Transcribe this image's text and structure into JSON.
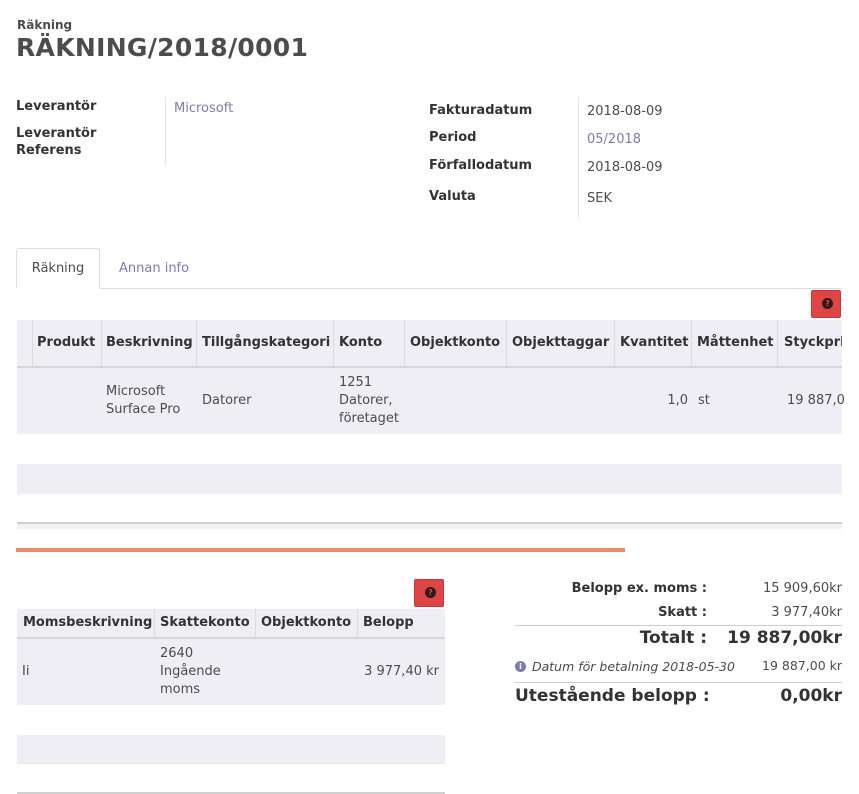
{
  "header": {
    "doc_type": "Räkning",
    "title": "RÄKNING/2018/0001"
  },
  "fields_left": {
    "supplier_label": "Leverantör",
    "supplier_value": "Microsoft",
    "ref_label_1": "Leverantör",
    "ref_label_2": "Referens",
    "ref_value": ""
  },
  "fields_right": {
    "invoice_date_label": "Fakturadatum",
    "invoice_date_value": "2018-08-09",
    "period_label": "Period",
    "period_value": "05/2018",
    "due_date_label": "Förfallodatum",
    "due_date_value": "2018-08-09",
    "currency_label": "Valuta",
    "currency_value": "SEK"
  },
  "tabs": [
    {
      "label": "Räkning",
      "active": true
    },
    {
      "label": "Annan info",
      "active": false
    }
  ],
  "lines": {
    "columns": [
      "Produkt",
      "Beskrivning",
      "Tillgångskategori",
      "Konto",
      "Objektkonto",
      "Objekttaggar",
      "Kvantitet",
      "Måttenhet",
      "Styckpri"
    ],
    "rows": [
      {
        "product": "",
        "description_1": "Microsoft",
        "description_2": "Surface Pro",
        "asset_category": "Datorer",
        "account_1": "1251",
        "account_2": "Datorer,",
        "account_3": "företaget",
        "analytic_account": "",
        "analytic_tags": "",
        "quantity": "1,0",
        "uom": "st",
        "unit_price": "19 887,0"
      }
    ]
  },
  "taxes": {
    "columns": [
      "Momsbeskrivning",
      "Skattekonto",
      "Objektkonto",
      "Belopp"
    ],
    "rows": [
      {
        "description": "Ii",
        "account_1": "2640",
        "account_2": "Ingående",
        "account_3": "moms",
        "analytic": "",
        "amount": "3 977,40 kr"
      }
    ]
  },
  "totals": {
    "untaxed_label": "Belopp ex. moms :",
    "untaxed_value": "15 909,60kr",
    "tax_label": "Skatt :",
    "tax_value": "3 977,40kr",
    "total_label": "Totalt :",
    "total_value": "19 887,00kr",
    "payment_label": "Datum för betalning 2018-05-30",
    "payment_value": "19 887,00 kr",
    "residual_label": "Utestående belopp :",
    "residual_value": "0,00kr"
  },
  "colors": {
    "accent": "#7c7bad",
    "help_button": "#e04545",
    "progress": "#f0896a",
    "row_bg": "#eeeef4"
  }
}
